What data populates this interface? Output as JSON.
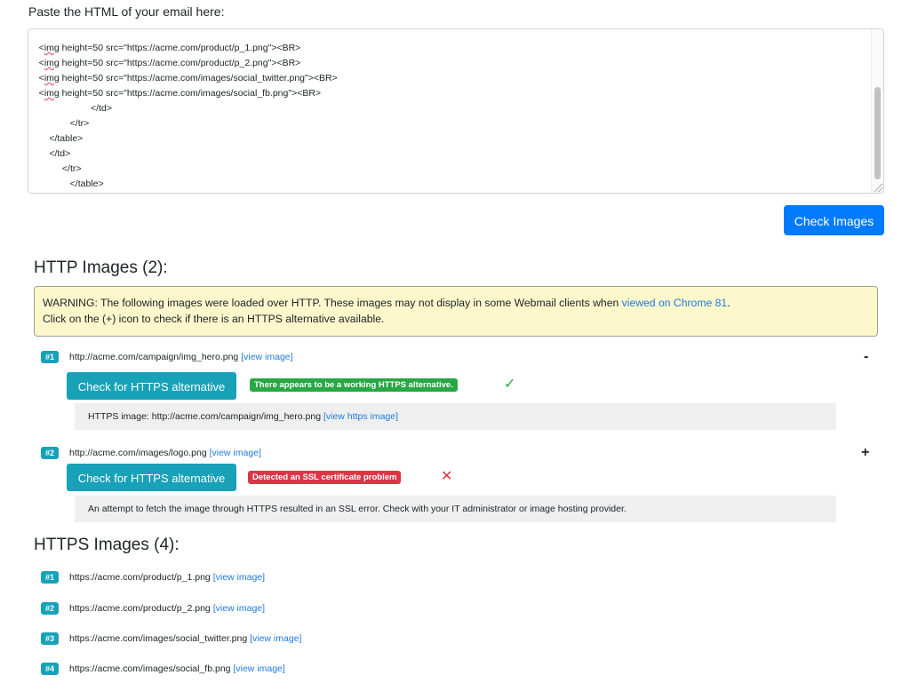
{
  "paste_label": "Paste the HTML of your email here:",
  "html_input": {
    "lines": [
      "    <img height=50 src=\"https://acme.com/product/p_1.png\"><BR>",
      "    <img height=50 src=\"https://acme.com/product/p_2.png\"><BR>",
      "    <img height=50 src=\"https://acme.com/images/social_twitter.png\"><BR>",
      "    <img height=50 src=\"https://acme.com/images/social_fb.png\"><BR>",
      "                        </td>",
      "                </tr>",
      "        </table>",
      "        </td>",
      "             </tr>",
      "                </table>"
    ]
  },
  "check_images_label": "Check Images",
  "http_section": {
    "title": "HTTP Images (2):",
    "warning": {
      "text_before": "WARNING: The following images were loaded over HTTP. These images may not display in some Webmail clients when ",
      "link": "viewed on Chrome 81",
      "text_after": ".",
      "line2": "Click on the (+) icon to check if there is an HTTPS alternative available."
    },
    "items": [
      {
        "num": "#1",
        "url": "http://acme.com/campaign/img_hero.png",
        "view_link": "[view image]",
        "toggle": "-",
        "button_label": "Check for HTTPS alternative",
        "status_label": "There appears to be a working HTTPS alternative.",
        "status_icon": "✓",
        "detail_text": "HTTPS image: http://acme.com/campaign/img_hero.png",
        "detail_link": "[view https image]"
      },
      {
        "num": "#2",
        "url": "http://acme.com/images/logo.png",
        "view_link": "[view image]",
        "toggle": "+",
        "button_label": "Check for HTTPS alternative",
        "status_label": "Detected an SSL certificate problem",
        "status_icon": "✕",
        "detail_text": "An attempt to fetch the image through HTTPS resulted in an SSL error. Check with your IT administrator or image hosting provider."
      }
    ]
  },
  "https_section": {
    "title": "HTTPS Images (4):",
    "items": [
      {
        "num": "#1",
        "url": "https://acme.com/product/p_1.png",
        "view_link": "[view image]"
      },
      {
        "num": "#2",
        "url": "https://acme.com/product/p_2.png",
        "view_link": "[view image]"
      },
      {
        "num": "#3",
        "url": "https://acme.com/images/social_twitter.png",
        "view_link": "[view image]"
      },
      {
        "num": "#4",
        "url": "https://acme.com/images/social_fb.png",
        "view_link": "[view image]"
      }
    ]
  },
  "colors": {
    "primary": "#007bff",
    "info": "#17a2b8",
    "success": "#28a745",
    "danger": "#dc3545",
    "warning_bg": "#fdf7cc",
    "link": "#1f7ae0"
  }
}
